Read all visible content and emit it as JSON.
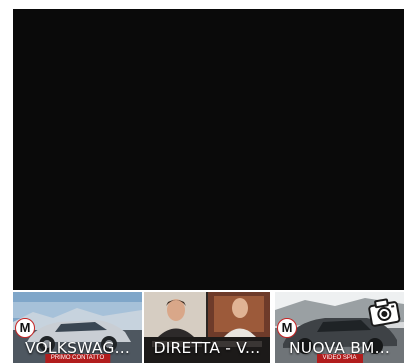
{
  "thumbnails": [
    {
      "title": "VOLKSWAG...",
      "subtitle": "PRIMO CONTATTO",
      "badge": "M"
    },
    {
      "title": "DIRETTA - V...",
      "subtitle": ""
    },
    {
      "title": "NUOVA BM...",
      "subtitle": "VIDEO SPIA",
      "badge": "M"
    }
  ],
  "icons": {
    "brand": "brand-logo-icon",
    "photo": "camera-icon"
  },
  "colors": {
    "player_bg": "#0a0a0a",
    "accent_red": "#b11d1d",
    "title_text": "#ffffff"
  }
}
